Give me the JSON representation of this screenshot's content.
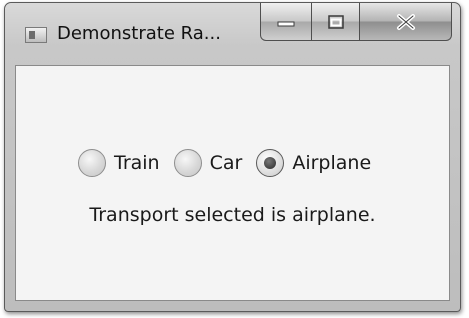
{
  "window": {
    "title": "Demonstrate Ra...",
    "app_icon": "app-window-icon",
    "caption_buttons": [
      {
        "name": "minimize-icon",
        "glyph": "—"
      },
      {
        "name": "maximize-icon",
        "glyph": "□"
      },
      {
        "name": "close-icon",
        "glyph": "X"
      }
    ]
  },
  "radios": [
    {
      "label": "Train",
      "checked": false
    },
    {
      "label": "Car",
      "checked": false
    },
    {
      "label": "Airplane",
      "checked": true
    }
  ],
  "status_text": "Transport selected is airplane."
}
